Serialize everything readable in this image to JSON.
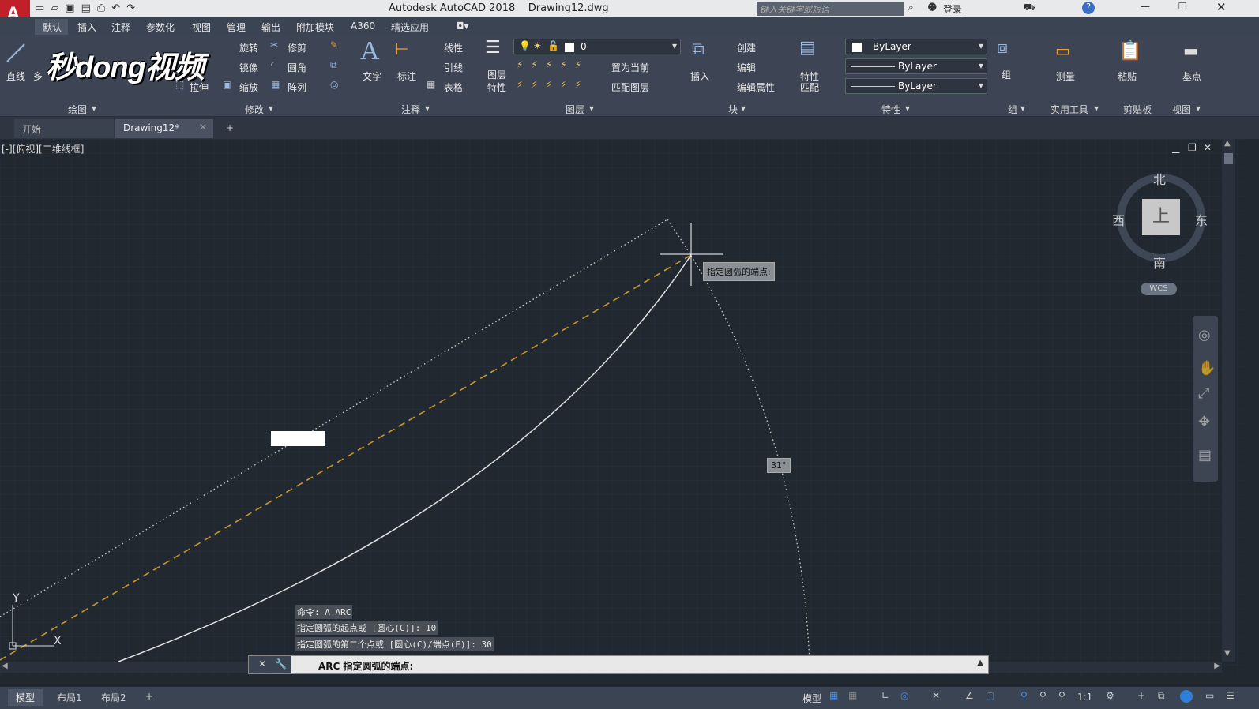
{
  "app_logo": "A",
  "title": "Autodesk AutoCAD 2018    Drawing12.dwg",
  "search_placeholder": "键入关键字或短语",
  "signin": "登录",
  "menu": [
    "默认",
    "插入",
    "注释",
    "参数化",
    "视图",
    "管理",
    "输出",
    "附加模块",
    "A360",
    "精选应用"
  ],
  "watermark": "秒dong视频",
  "draw": {
    "line": "直线",
    "multi": "多",
    "panel": "绘图"
  },
  "modify": {
    "rotate": "旋转",
    "trim": "修剪",
    "mirror": "镜像",
    "fillet": "圆角",
    "stretch": "拉伸",
    "scale": "缩放",
    "array": "阵列",
    "panel": "修改"
  },
  "annotation": {
    "text": "文字",
    "dim": "标注",
    "linear": "线性",
    "leader": "引线",
    "table": "表格",
    "panel": "注释"
  },
  "layers": {
    "props": "图层\n特性",
    "props_l1": "图层",
    "props_l2": "特性",
    "current": "0",
    "setcurrent": "置为当前",
    "match": "匹配图层",
    "panel": "图层"
  },
  "block": {
    "insert": "插入",
    "create": "创建",
    "edit": "编辑",
    "editattr": "编辑属性",
    "panel": "块"
  },
  "properties": {
    "match_l1": "特性",
    "match_l2": "匹配",
    "color": "ByLayer",
    "linetype": "ByLayer",
    "lineweight": "ByLayer",
    "panel": "特性"
  },
  "group": {
    "label": "组",
    "panel": "组"
  },
  "utilities": {
    "measure": "测量",
    "panel": "实用工具"
  },
  "clipboard": {
    "paste": "粘贴",
    "panel": "剪贴板"
  },
  "view": {
    "base": "基点",
    "panel": "视图"
  },
  "tabs": {
    "start": "开始",
    "drawing": "Drawing12*"
  },
  "viewport_label": "[-][俯视][二维线框]",
  "viewcube": {
    "north": "北",
    "south": "南",
    "west": "西",
    "east": "东",
    "top": "上",
    "wcs": "WCS"
  },
  "tooltip": "指定圆弧的端点:",
  "angle": "31°",
  "ucs": {
    "x": "X",
    "y": "Y"
  },
  "history": [
    "命令: A ARC",
    "指定圆弧的起点或 [圆心(C)]: 10",
    "指定圆弧的第二个点或 [圆心(C)/端点(E)]: 30"
  ],
  "command_prompt": "ARC 指定圆弧的端点:",
  "layout_tabs": [
    "模型",
    "布局1",
    "布局2"
  ],
  "status": {
    "model": "模型",
    "scale": "1:1"
  },
  "colors": {
    "bg": "#212830",
    "ribbon": "#3d4554",
    "accent": "#c0202a",
    "dashed": "#c8962a"
  }
}
